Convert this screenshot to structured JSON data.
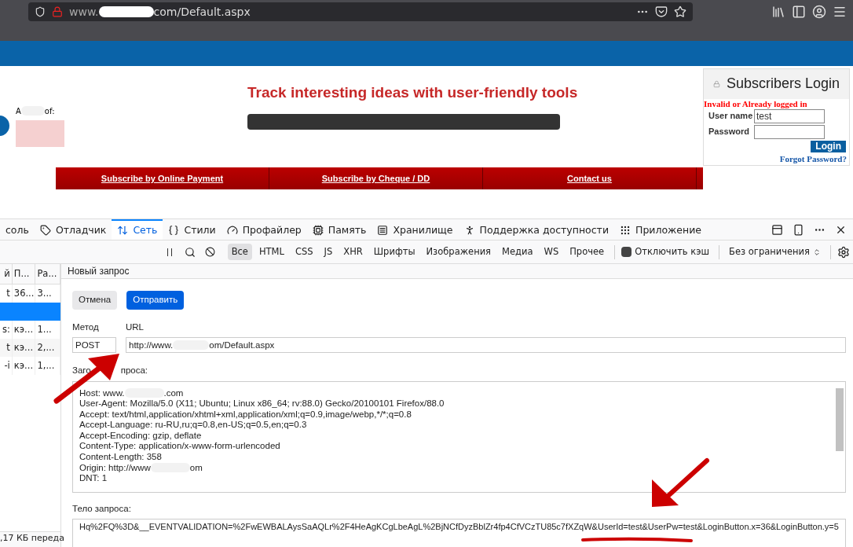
{
  "browser": {
    "url_prefix": "www.",
    "url_suffix": "com/Default.aspx"
  },
  "site": {
    "headline": "Track interesting ideas with user-friendly tools",
    "partner_start": "A",
    "partner_end": "of:",
    "nav": [
      "Subscribe by Online Payment",
      "Subscribe by Cheque / DD",
      "Contact us"
    ],
    "login": {
      "title": "Subscribers Login",
      "error": "Invalid or Already logged in",
      "user_label": "User name",
      "user_value": "test",
      "pass_label": "Password",
      "button": "Login",
      "forgot": "Forgot Password?"
    }
  },
  "devtools": {
    "tabs": [
      {
        "label": "соль",
        "selected": false
      },
      {
        "label": "Отладчик",
        "selected": false
      },
      {
        "label": "Сеть",
        "selected": true
      },
      {
        "label": "Стили",
        "selected": false
      },
      {
        "label": "Профайлер",
        "selected": false
      },
      {
        "label": "Память",
        "selected": false
      },
      {
        "label": "Хранилище",
        "selected": false
      },
      {
        "label": "Поддержка доступности",
        "selected": false
      },
      {
        "label": "Приложение",
        "selected": false
      }
    ],
    "filters": [
      {
        "label": "Все",
        "selected": true
      },
      {
        "label": "HTML",
        "selected": false
      },
      {
        "label": "CSS",
        "selected": false
      },
      {
        "label": "JS",
        "selected": false
      },
      {
        "label": "XHR",
        "selected": false
      },
      {
        "label": "Шрифты",
        "selected": false
      },
      {
        "label": "Изображения",
        "selected": false
      },
      {
        "label": "Медиа",
        "selected": false
      },
      {
        "label": "WS",
        "selected": false
      },
      {
        "label": "Прочее",
        "selected": false
      }
    ],
    "disable_cache": {
      "label": "Отключить кэш",
      "checked": false
    },
    "throttle": "Без ограничения",
    "list": {
      "columns": [
        "й",
        "П...",
        "Ра..."
      ],
      "rows": [
        {
          "cells": [
            "t",
            "36...",
            "3..."
          ],
          "selected": false
        },
        {
          "cells": [],
          "selected": true
        },
        {
          "cells": [
            "s:",
            "кэ...",
            "1..."
          ],
          "selected": false
        },
        {
          "cells": [
            "t",
            "кэ...",
            "2,..."
          ],
          "selected": false
        },
        {
          "cells": [
            "-i",
            "кэ...",
            "1,..."
          ],
          "selected": false
        }
      ],
      "status": ",17 КБ переда"
    },
    "editor": {
      "title": "Новый запрос",
      "cancel": "Отмена",
      "send": "Отправить",
      "method_label": "Метод",
      "url_label": "URL",
      "method": "POST",
      "url_prefix": "http://www.",
      "url_suffix": "om/Default.aspx",
      "headers_label_start": "Заго",
      "headers_label_end": "проса:",
      "headers": [
        {
          "text": "Host: www.",
          "after": ".com"
        },
        {
          "text": "User-Agent: Mozilla/5.0 (X11; Ubuntu; Linux x86_64; rv:88.0) Gecko/20100101 Firefox/88.0"
        },
        {
          "text": "Accept: text/html,application/xhtml+xml,application/xml;q=0.9,image/webp,*/*;q=0.8"
        },
        {
          "text": "Accept-Language: ru-RU,ru;q=0.8,en-US;q=0.5,en;q=0.3"
        },
        {
          "text": "Accept-Encoding: gzip, deflate"
        },
        {
          "text": "Content-Type: application/x-www-form-urlencoded"
        },
        {
          "text": "Content-Length: 358"
        },
        {
          "text": "Origin: http://www",
          "after": "om"
        },
        {
          "text": "DNT: 1"
        }
      ],
      "body_label": "Тело запроса:",
      "body": "Hq%2FQ%3D&__EVENTVALIDATION=%2FwEWBALAysSaAQLr%2F4HeAgKCgLbeAgL%2BjNCfDyzBblZr4fp4CfVCzTU85c7fXZqW&UserId=test&UserPw=test&LoginButton.x=36&LoginButton.y=5"
    }
  }
}
